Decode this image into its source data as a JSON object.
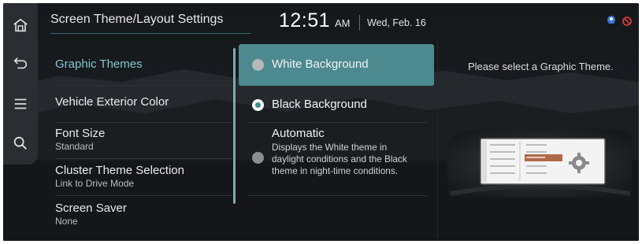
{
  "header": {
    "title": "Screen Theme/Layout Settings",
    "time": "12:51",
    "ampm": "AM",
    "date": "Wed, Feb. 16"
  },
  "rail": {
    "items": [
      {
        "icon": "home-icon"
      },
      {
        "icon": "back-icon"
      },
      {
        "icon": "menu-icon"
      },
      {
        "icon": "search-icon"
      }
    ]
  },
  "menu": {
    "items": [
      {
        "label": "Graphic Themes",
        "sub": ""
      },
      {
        "label": "Vehicle Exterior Color",
        "sub": ""
      },
      {
        "label": "Font Size",
        "sub": "Standard"
      },
      {
        "label": "Cluster Theme Selection",
        "sub": "Link to Drive Mode"
      },
      {
        "label": "Screen Saver",
        "sub": "None"
      }
    ]
  },
  "options": {
    "items": [
      {
        "label": "White Background",
        "desc": ""
      },
      {
        "label": "Black Background",
        "desc": ""
      },
      {
        "label": "Automatic",
        "desc": "Displays the White theme in daylight conditions and the Black theme in night-time conditions."
      }
    ],
    "checked_index": 1
  },
  "info": {
    "prompt": "Please select a Graphic Theme."
  },
  "colors": {
    "accent": "#4c8a90",
    "active_text": "#7fc7cf",
    "background": "#111417"
  }
}
